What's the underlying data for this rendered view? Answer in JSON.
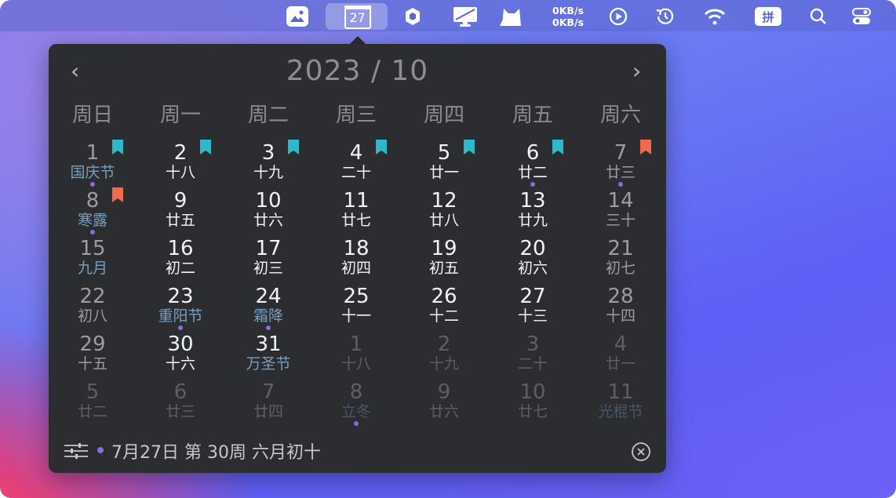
{
  "menubar": {
    "calendar_day": "27",
    "net_up": "0KB/s",
    "net_down": "0KB/s",
    "input_method": "拼",
    "icons": [
      "photo-icon",
      "calendar-icon",
      "hexagon-icon",
      "display-icon",
      "cat-icon",
      "play-icon",
      "history-icon",
      "wifi-icon",
      "pinyin-icon",
      "search-icon",
      "control-center-icon"
    ]
  },
  "calendar": {
    "title": "2023 / 10",
    "prev": "‹",
    "next": "›",
    "weekdays": [
      "周日",
      "周一",
      "周二",
      "周三",
      "周四",
      "周五",
      "周六"
    ],
    "days": [
      {
        "n": "1",
        "l": "国庆节",
        "t": "fest wkend",
        "flag": "#2fb8c8",
        "dot": true
      },
      {
        "n": "2",
        "l": "十八",
        "t": "cur",
        "flag": "#2fb8c8"
      },
      {
        "n": "3",
        "l": "十九",
        "t": "cur",
        "flag": "#2fb8c8"
      },
      {
        "n": "4",
        "l": "二十",
        "t": "cur",
        "flag": "#2fb8c8"
      },
      {
        "n": "5",
        "l": "廿一",
        "t": "cur",
        "flag": "#2fb8c8"
      },
      {
        "n": "6",
        "l": "廿二",
        "t": "cur",
        "flag": "#2fb8c8",
        "dot": true
      },
      {
        "n": "7",
        "l": "廿三",
        "t": "wkend",
        "flag": "#f06a50",
        "dot": true
      },
      {
        "n": "8",
        "l": "寒露",
        "t": "fest wkend",
        "flag": "#f06a50",
        "dot": true
      },
      {
        "n": "9",
        "l": "廿五",
        "t": "cur"
      },
      {
        "n": "10",
        "l": "廿六",
        "t": "cur"
      },
      {
        "n": "11",
        "l": "廿七",
        "t": "cur"
      },
      {
        "n": "12",
        "l": "廿八",
        "t": "cur"
      },
      {
        "n": "13",
        "l": "廿九",
        "t": "cur"
      },
      {
        "n": "14",
        "l": "三十",
        "t": "wkend"
      },
      {
        "n": "15",
        "l": "九月",
        "t": "fest wkend"
      },
      {
        "n": "16",
        "l": "初二",
        "t": "cur"
      },
      {
        "n": "17",
        "l": "初三",
        "t": "cur"
      },
      {
        "n": "18",
        "l": "初四",
        "t": "cur"
      },
      {
        "n": "19",
        "l": "初五",
        "t": "cur"
      },
      {
        "n": "20",
        "l": "初六",
        "t": "cur"
      },
      {
        "n": "21",
        "l": "初七",
        "t": "wkend"
      },
      {
        "n": "22",
        "l": "初八",
        "t": "wkend"
      },
      {
        "n": "23",
        "l": "重阳节",
        "t": "cur fest",
        "dot": true
      },
      {
        "n": "24",
        "l": "霜降",
        "t": "cur fest",
        "dot": true
      },
      {
        "n": "25",
        "l": "十一",
        "t": "cur"
      },
      {
        "n": "26",
        "l": "十二",
        "t": "cur"
      },
      {
        "n": "27",
        "l": "十三",
        "t": "cur"
      },
      {
        "n": "28",
        "l": "十四",
        "t": "wkend"
      },
      {
        "n": "29",
        "l": "十五",
        "t": "wkend"
      },
      {
        "n": "30",
        "l": "十六",
        "t": "cur"
      },
      {
        "n": "31",
        "l": "万圣节",
        "t": "cur fest"
      },
      {
        "n": "1",
        "l": "十八",
        "t": "other"
      },
      {
        "n": "2",
        "l": "十九",
        "t": "other"
      },
      {
        "n": "3",
        "l": "二十",
        "t": "other"
      },
      {
        "n": "4",
        "l": "廿一",
        "t": "other"
      },
      {
        "n": "5",
        "l": "廿二",
        "t": "other"
      },
      {
        "n": "6",
        "l": "廿三",
        "t": "other"
      },
      {
        "n": "7",
        "l": "廿四",
        "t": "other"
      },
      {
        "n": "8",
        "l": "立冬",
        "t": "other fest",
        "dot": true
      },
      {
        "n": "9",
        "l": "廿六",
        "t": "other"
      },
      {
        "n": "10",
        "l": "廿七",
        "t": "other"
      },
      {
        "n": "11",
        "l": "光棍节",
        "t": "other fest"
      }
    ],
    "footer": "7月27日 第 30周 六月初十"
  }
}
